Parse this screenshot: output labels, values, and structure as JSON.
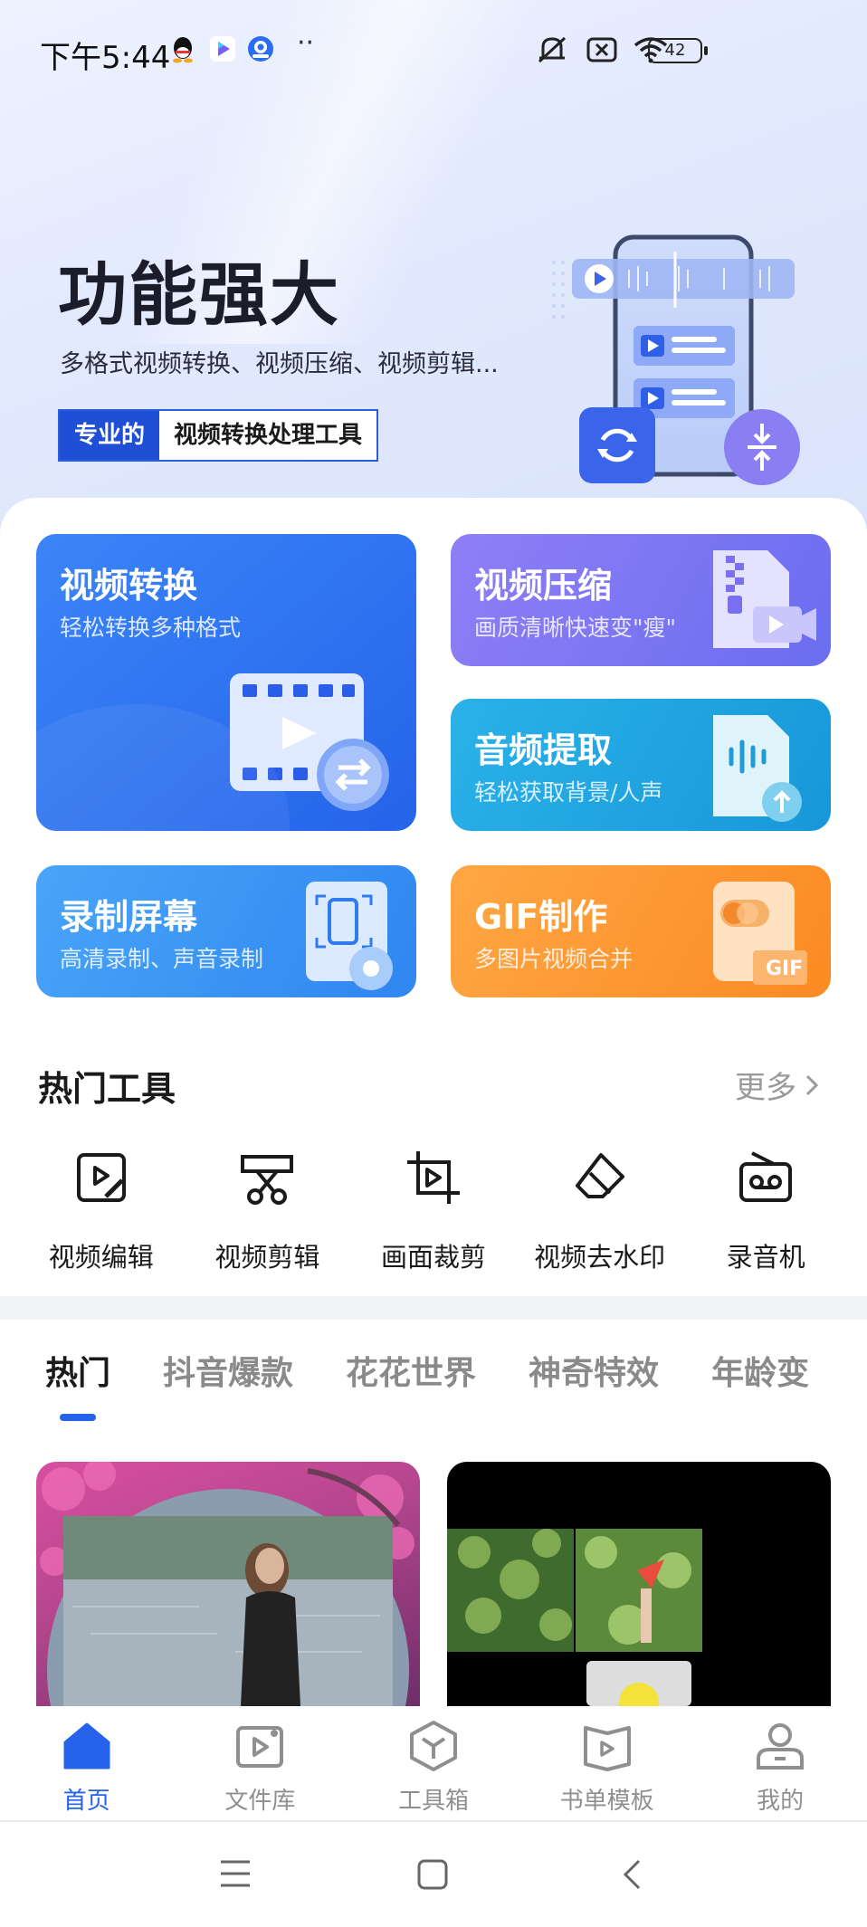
{
  "status_bar": {
    "time": "下午5:44",
    "dots": "··",
    "battery": "42",
    "icons": [
      "qq-icon",
      "video-app-icon",
      "browser-app-icon",
      "mute-icon",
      "sim-off-icon",
      "wifi-icon",
      "battery-icon"
    ]
  },
  "hero": {
    "title": "功能强大",
    "subtitle": "多格式视频转换、视频压缩、视频剪辑...",
    "badge_highlight": "专业的",
    "badge_text": "视频转换处理工具"
  },
  "cards": {
    "convert": {
      "title": "视频转换",
      "subtitle": "轻松转换多种格式"
    },
    "compress": {
      "title": "视频压缩",
      "subtitle": "画质清晰快速变\"瘦\""
    },
    "audio": {
      "title": "音频提取",
      "subtitle": "轻松获取背景/人声"
    },
    "record": {
      "title": "录制屏幕",
      "subtitle": "高清录制、声音录制"
    },
    "gif": {
      "title": "GIF制作",
      "subtitle": "多图片视频合并"
    }
  },
  "hot_tools": {
    "title": "热门工具",
    "more": "更多",
    "items": [
      {
        "label": "视频编辑",
        "icon": "video-edit-icon"
      },
      {
        "label": "视频剪辑",
        "icon": "scissors-icon"
      },
      {
        "label": "画面裁剪",
        "icon": "crop-icon"
      },
      {
        "label": "视频去水印",
        "icon": "eraser-icon"
      },
      {
        "label": "录音机",
        "icon": "recorder-icon"
      }
    ]
  },
  "tabs": [
    "热门",
    "抖音爆款",
    "花花世界",
    "神奇特效",
    "年龄变"
  ],
  "active_tab": 0,
  "bottom_nav": [
    {
      "label": "首页",
      "icon": "home-icon",
      "active": true
    },
    {
      "label": "文件库",
      "icon": "file-library-icon",
      "active": false
    },
    {
      "label": "工具箱",
      "icon": "toolbox-icon",
      "active": false
    },
    {
      "label": "书单模板",
      "icon": "book-template-icon",
      "active": false
    },
    {
      "label": "我的",
      "icon": "profile-icon",
      "active": false
    }
  ],
  "colors": {
    "accent": "#2563ea",
    "convert_card": "#2f73f0",
    "compress_card": "#7b76f3",
    "audio_card": "#1fa5e0",
    "record_card": "#3b95f4",
    "gif_card": "#fd972f"
  }
}
